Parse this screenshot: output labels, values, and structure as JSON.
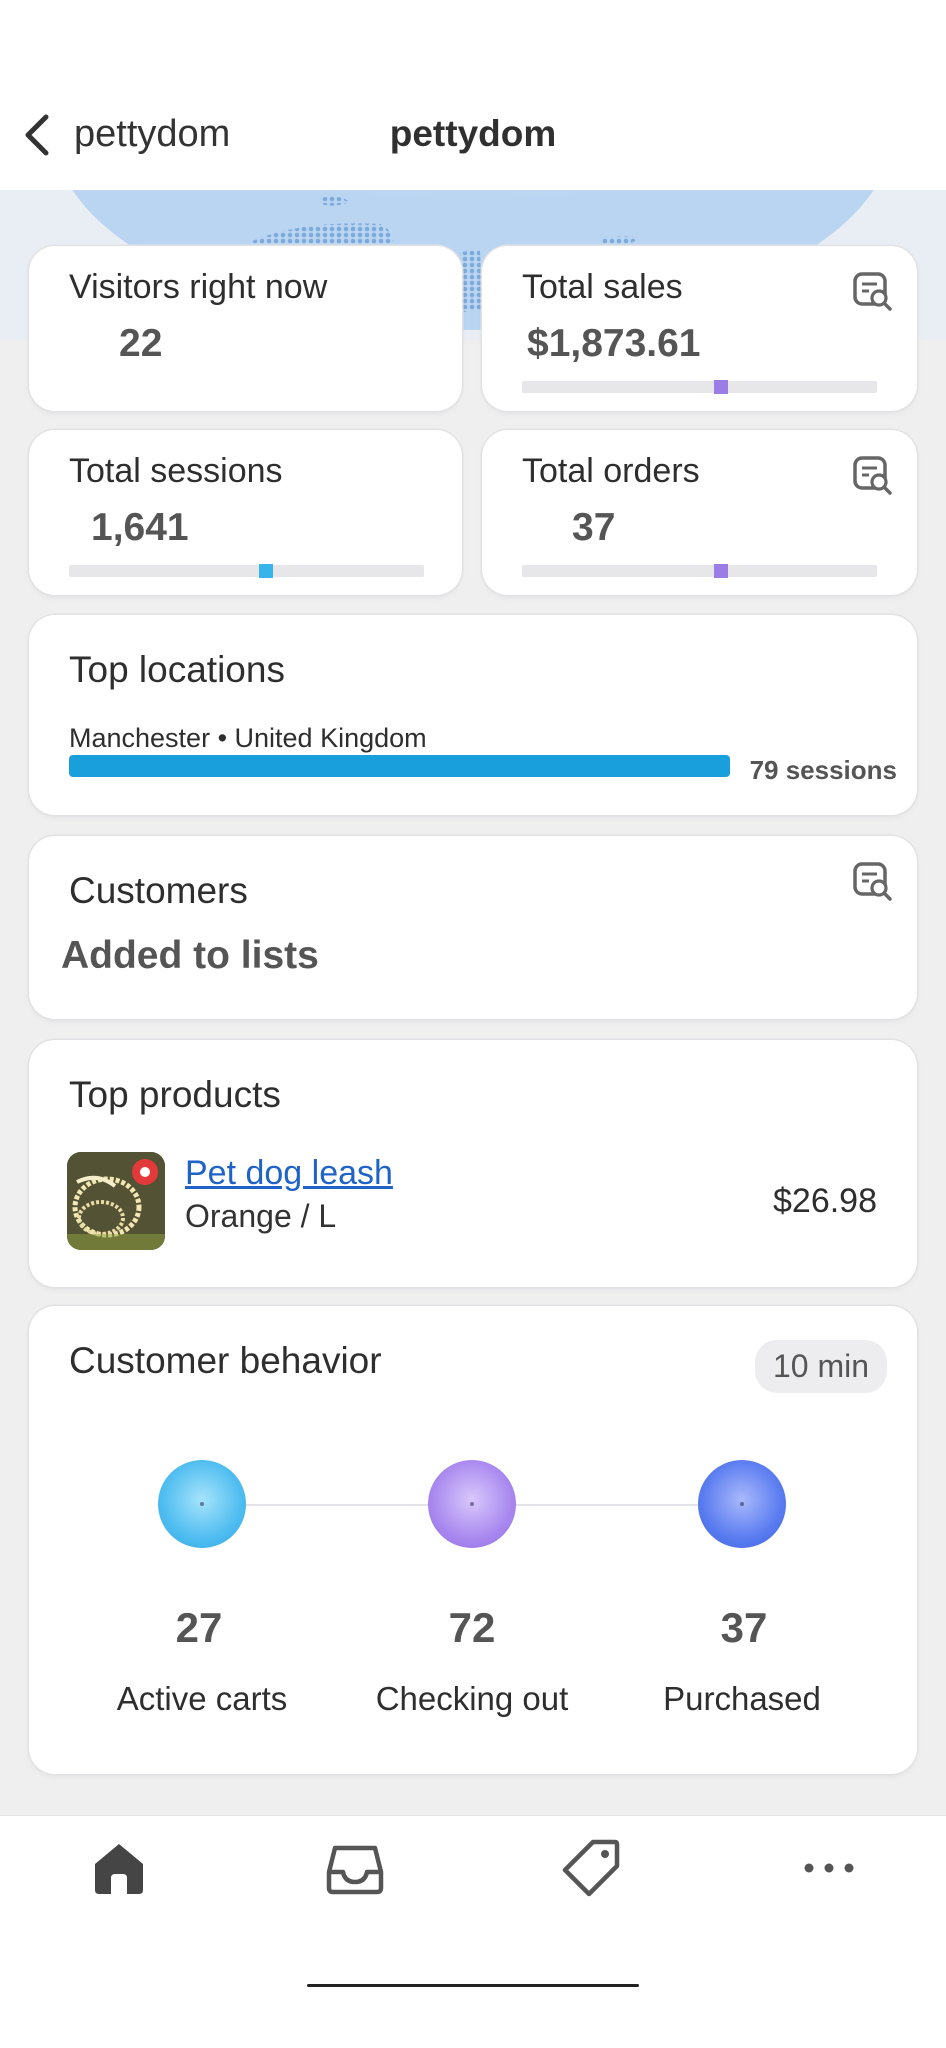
{
  "header": {
    "back_label": "pettydom",
    "title": "pettydom"
  },
  "visitors": {
    "label": "Visitors right now",
    "value": "22"
  },
  "sales": {
    "label": "Total sales",
    "value": "$1,873.61",
    "icon": "search-report-icon",
    "accent": "#9b7de6"
  },
  "sessions": {
    "label": "Total sessions",
    "value": "1,641",
    "accent": "#38b3ec"
  },
  "orders": {
    "label": "Total orders",
    "value": "37",
    "icon": "search-report-icon",
    "accent": "#9b7de6"
  },
  "locations": {
    "title": "Top locations",
    "place": "Manchester • United Kingdom",
    "sessions": "79 sessions",
    "bar_color": "#1a9fdd"
  },
  "customers": {
    "title": "Customers",
    "subtitle": "Added to lists",
    "icon": "search-report-icon"
  },
  "products": {
    "title": "Top products",
    "items": [
      {
        "name": "Pet dog leash",
        "variant": "Orange / L",
        "price": "$26.98"
      }
    ]
  },
  "behavior": {
    "title": "Customer behavior",
    "period": "10 min",
    "steps": [
      {
        "value": "27",
        "label": "Active carts",
        "color": "#4fbdf0"
      },
      {
        "value": "72",
        "label": "Checking out",
        "color": "#a989ef"
      },
      {
        "value": "37",
        "label": "Purchased",
        "color": "#5a7cf0"
      }
    ]
  },
  "tabbar": {
    "icons": [
      "home-icon",
      "inbox-icon",
      "tag-icon",
      "more-icon"
    ]
  }
}
